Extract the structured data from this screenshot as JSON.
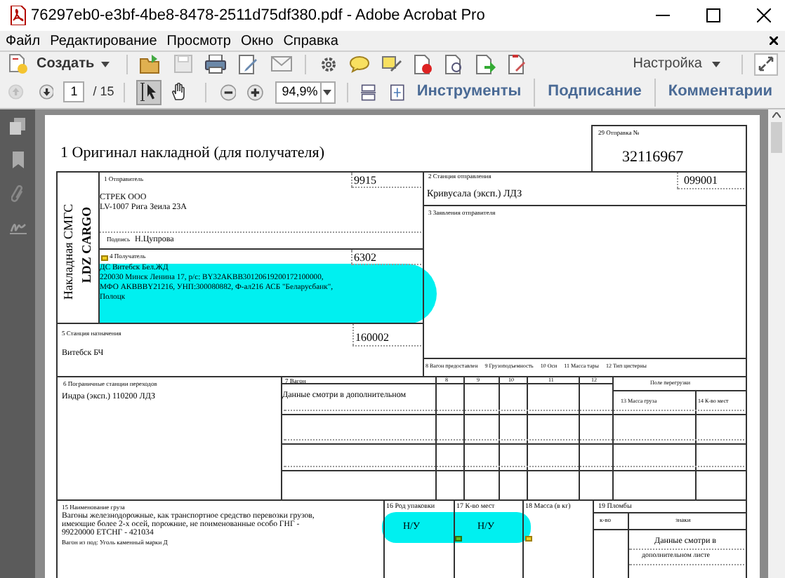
{
  "window": {
    "title": "76297eb0-e3bf-4be8-8478-2511d75df380.pdf - Adobe Acrobat Pro"
  },
  "menu": [
    "Файл",
    "Редактирование",
    "Просмотр",
    "Окно",
    "Справка"
  ],
  "toolbar": {
    "create_label": "Создать",
    "customize_label": "Настройка"
  },
  "nav": {
    "page": "1",
    "page_count": "/ 15",
    "zoom": "94,9%"
  },
  "tools": [
    {
      "kind": "select",
      "selected": true
    },
    {
      "kind": "hand",
      "selected": false
    }
  ],
  "panels": [
    "Инструменты",
    "Подписание",
    "Комментарии"
  ],
  "document": {
    "heading": "1 Оригинал накладной (для получателя)",
    "shipment": {
      "label": "29 Отправка №",
      "value": "32116967"
    },
    "side_texts": [
      "Накладная СМГС",
      "LDZ CARGO"
    ],
    "sender": {
      "label": "1 Отправитель",
      "code": "9915",
      "lines": [
        "СТРЕК ООО",
        "LV-1007 Рига Зеила 23А"
      ],
      "signature_label": "Подпись",
      "signature": "Н.Цупрова"
    },
    "recipient": {
      "label": "4 Получатель",
      "code": "6302",
      "lines": [
        "ДС Витебск Бел.ЖД",
        "220030 Минск Ленина 17, р/с: BY32AKBB30120619200172100000,",
        "МФО AKBBBY21216, УНП:300080882, Ф-ал216 АСБ \"Беларусбанк\",",
        "Полоцк"
      ]
    },
    "departure": {
      "label": "2 Станция отправления",
      "code": "099001",
      "value": "Кривусала (эксп.) ЛДЗ"
    },
    "statements": {
      "label": "3 Заявления отправителя"
    },
    "wagon_header": [
      "8 Вагон предоставлен",
      "9 Грузоподъемность",
      "10 Оси",
      "11 Масса тары",
      "12 Тип цистерны"
    ],
    "destination": {
      "label": "5 Станция назначения",
      "code": "160002",
      "value": "Витебск БЧ"
    },
    "border_stations": {
      "label": "6 Пограничные станции переходов",
      "value": "Индра (эксп.) 110200 ЛДЗ"
    },
    "wagon": {
      "label": "7 Вагон",
      "value": "Данные смотри в дополнительном",
      "columns": [
        "8",
        "9",
        "10",
        "11",
        "12"
      ],
      "reload_label": "Поле перегрузки",
      "reload_columns": [
        "13 Масса груза",
        "14 К-во мест"
      ]
    },
    "cargo": {
      "label": "15 Наименование груза",
      "lines": [
        "Вагоны железнодорожные, как транспортное средство перевозки грузов,",
        "имеющие более 2-х осей, порожние, не поименованные особо ГНГ -",
        "99220000 ЕТСНГ - 421034"
      ],
      "note": "Вагон из под: Уголь каменный марки Д"
    },
    "packaging": {
      "label": "16 Род упаковки",
      "value": "Н/У"
    },
    "places": {
      "label": "17 К-во мест",
      "value": "Н/У"
    },
    "mass": {
      "label": "18 Масса (в кг)"
    },
    "seals": {
      "label": "19 Пломбы",
      "columns": [
        "к-во",
        "знаки"
      ],
      "lines": [
        "Данные смотри в",
        "дополнительном листе"
      ]
    }
  }
}
